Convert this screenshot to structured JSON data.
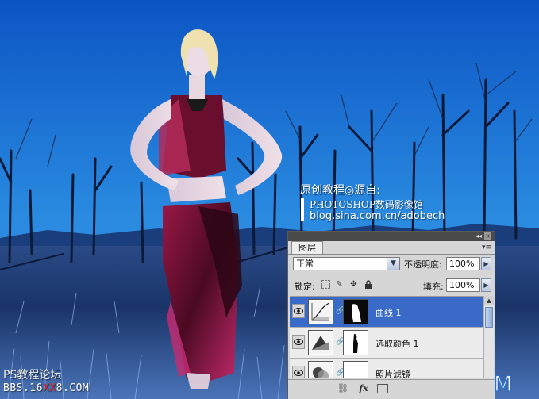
{
  "credit": {
    "title": "原创教程◎源自:",
    "line1": "PHOTOSHOP数码影像馆",
    "line2": "blog.sina.com.cn/adobech"
  },
  "watermark": {
    "forum_name": "PS教程论坛",
    "forum_url_prefix": "BBS.16",
    "forum_url_red": "XX",
    "forum_url_suffix": "8.COM",
    "logo_text": "UiBQ.CoM"
  },
  "layers_panel": {
    "tab_label": "图层",
    "blend_mode": "正常",
    "opacity_label": "不透明度:",
    "opacity_value": "100%",
    "lock_label": "锁定:",
    "fill_label": "填充:",
    "fill_value": "100%",
    "collapse_glyph": "◂◂",
    "close_glyph": "×",
    "menu_glyph": "▾≡",
    "layers": [
      {
        "name": "曲线 1",
        "type": "curves-adjustment",
        "selected": true,
        "visible": true
      },
      {
        "name": "选取颜色 1",
        "type": "selective-color-adjustment",
        "selected": false,
        "visible": true
      },
      {
        "name": "照片滤镜",
        "type": "photo-filter-adjustment",
        "selected": false,
        "visible": true
      }
    ],
    "bottom_icons": {
      "link": "link-icon",
      "fx": "fx",
      "mask": "add-mask-icon"
    }
  },
  "colors": {
    "sky_top": "#0a58c6",
    "sky_bottom": "#2a8de0",
    "ground": "#1e3e78",
    "selection": "#3a6ac8",
    "dress": "#7a1034"
  }
}
